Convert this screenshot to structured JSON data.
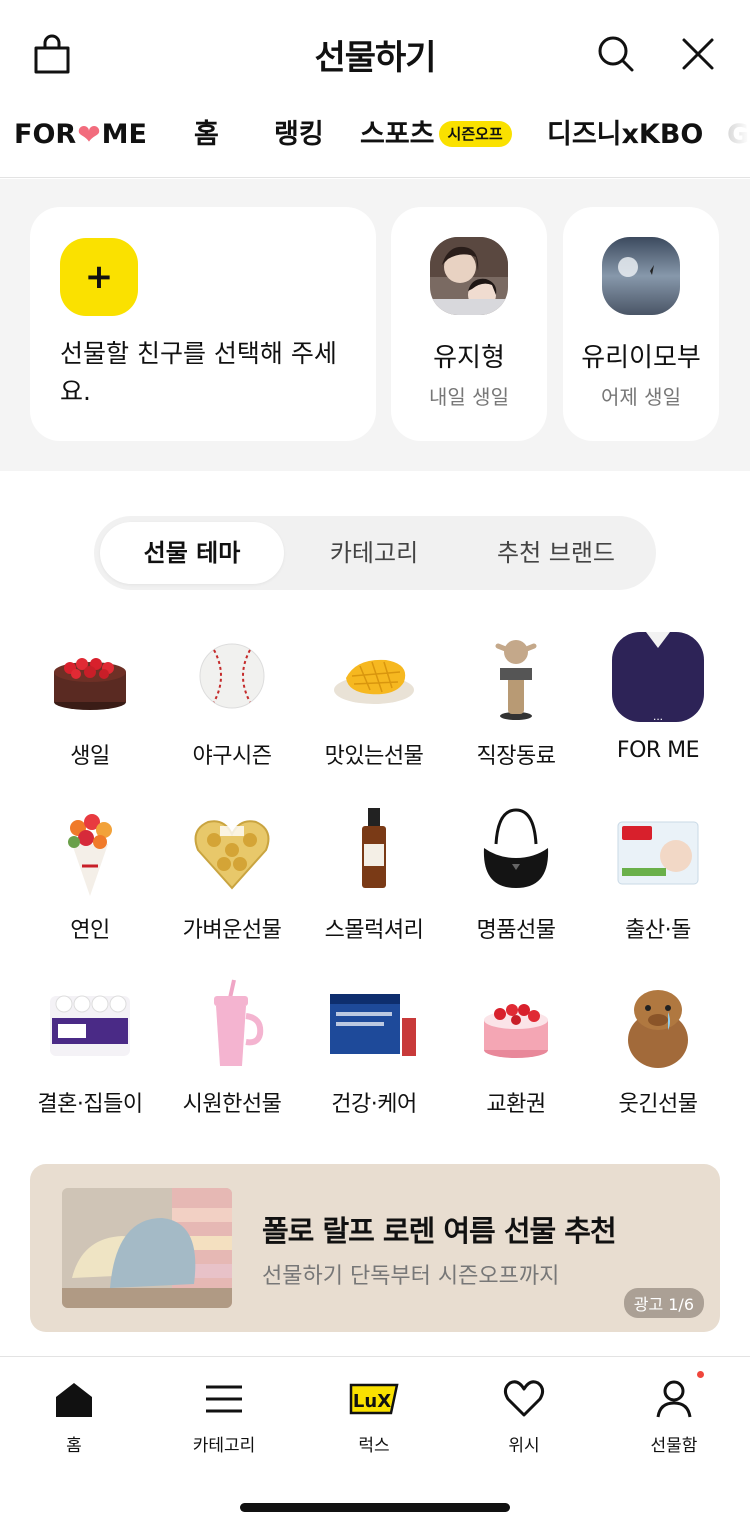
{
  "header": {
    "title": "선물하기",
    "icons": [
      "shopping-bag-icon",
      "search-icon",
      "close-icon"
    ]
  },
  "tabs": {
    "items": [
      {
        "label_left": "FOR",
        "label_right": "ME"
      },
      {
        "label": "홈"
      },
      {
        "label": "랭킹"
      },
      {
        "label": "스포츠",
        "badge": "시즌오프"
      },
      {
        "label": "디즈니xKBO"
      },
      {
        "label": "G"
      }
    ],
    "active_index": 1
  },
  "friends": {
    "add_text": "선물할 친구를 선택해 주세요.",
    "add_symbol": "+",
    "list": [
      {
        "name": "유지형",
        "sub": "내일 생일"
      },
      {
        "name": "유리이모부",
        "sub": "어제 생일"
      }
    ]
  },
  "segment": {
    "items": [
      "선물 테마",
      "카테고리",
      "추천 브랜드"
    ],
    "active_index": 0
  },
  "themes": [
    {
      "label": "생일"
    },
    {
      "label": "야구시즌"
    },
    {
      "label": "맛있는선물"
    },
    {
      "label": "직장동료"
    },
    {
      "label": "FOR ME"
    },
    {
      "label": "연인"
    },
    {
      "label": "가벼운선물"
    },
    {
      "label": "스몰럭셔리"
    },
    {
      "label": "명품선물"
    },
    {
      "label": "출산·돌"
    },
    {
      "label": "결혼·집들이"
    },
    {
      "label": "시원한선물"
    },
    {
      "label": "건강·케어"
    },
    {
      "label": "교환권"
    },
    {
      "label": "웃긴선물"
    }
  ],
  "banner": {
    "title": "폴로 랄프 로렌 여름 선물 추천",
    "subtitle": "선물하기 단독부터 시즌오프까지",
    "ad_label": "광고 1/6"
  },
  "bottom_nav": {
    "items": [
      "홈",
      "카테고리",
      "럭스",
      "위시",
      "선물함"
    ],
    "lux_icon_text": "LuX"
  },
  "colors": {
    "accent_yellow": "#fae100",
    "heart_pink": "#f26c7d",
    "notification_red": "#f0463c"
  }
}
